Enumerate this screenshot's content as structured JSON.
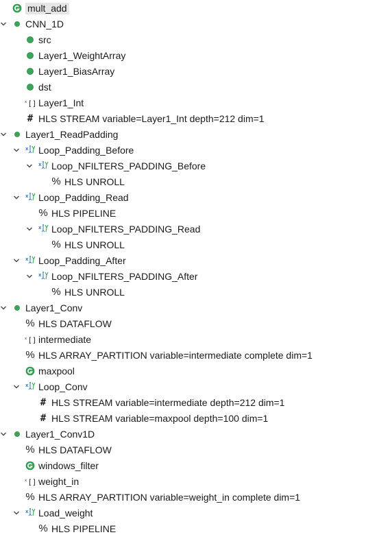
{
  "tree": [
    {
      "label": "mult_add",
      "icon": "function-icon",
      "depth": 0,
      "expanded": null,
      "selected": true
    },
    {
      "label": "CNN_1D",
      "icon": "top-function-icon",
      "depth": 0,
      "expanded": true
    },
    {
      "label": "src",
      "icon": "port-icon",
      "depth": 1,
      "expanded": null
    },
    {
      "label": "Layer1_WeightArray",
      "icon": "port-icon",
      "depth": 1,
      "expanded": null
    },
    {
      "label": "Layer1_BiasArray",
      "icon": "port-icon",
      "depth": 1,
      "expanded": null
    },
    {
      "label": "dst",
      "icon": "port-icon",
      "depth": 1,
      "expanded": null
    },
    {
      "label": "Layer1_Int",
      "icon": "array-icon",
      "depth": 1,
      "expanded": null
    },
    {
      "label": "HLS STREAM variable=Layer1_Int depth=212 dim=1",
      "icon": "hash-directive-icon",
      "depth": 1,
      "expanded": null
    },
    {
      "label": "Layer1_ReadPadding",
      "icon": "top-function-icon",
      "depth": 0,
      "expanded": true
    },
    {
      "label": "Loop_Padding_Before",
      "icon": "loop-icon",
      "depth": 1,
      "expanded": true
    },
    {
      "label": "Loop_NFILTERS_PADDING_Before",
      "icon": "loop-icon",
      "depth": 2,
      "expanded": true
    },
    {
      "label": "HLS UNROLL",
      "icon": "percent-directive-icon",
      "depth": 3,
      "expanded": null
    },
    {
      "label": "Loop_Padding_Read",
      "icon": "loop-icon",
      "depth": 1,
      "expanded": true
    },
    {
      "label": "HLS PIPELINE",
      "icon": "percent-directive-icon",
      "depth": 2,
      "expanded": null
    },
    {
      "label": "Loop_NFILTERS_PADDING_Read",
      "icon": "loop-icon",
      "depth": 2,
      "expanded": true
    },
    {
      "label": "HLS UNROLL",
      "icon": "percent-directive-icon",
      "depth": 3,
      "expanded": null
    },
    {
      "label": "Loop_Padding_After",
      "icon": "loop-icon",
      "depth": 1,
      "expanded": true
    },
    {
      "label": "Loop_NFILTERS_PADDING_After",
      "icon": "loop-icon",
      "depth": 2,
      "expanded": true
    },
    {
      "label": "HLS UNROLL",
      "icon": "percent-directive-icon",
      "depth": 3,
      "expanded": null
    },
    {
      "label": "Layer1_Conv",
      "icon": "top-function-icon",
      "depth": 0,
      "expanded": true
    },
    {
      "label": "HLS DATAFLOW",
      "icon": "percent-directive-icon",
      "depth": 1,
      "expanded": null
    },
    {
      "label": "intermediate",
      "icon": "array-icon",
      "depth": 1,
      "expanded": null
    },
    {
      "label": "HLS ARRAY_PARTITION variable=intermediate complete dim=1",
      "icon": "percent-directive-icon",
      "depth": 1,
      "expanded": null
    },
    {
      "label": "maxpool",
      "icon": "function-icon",
      "depth": 1,
      "expanded": null
    },
    {
      "label": "Loop_Conv",
      "icon": "loop-icon",
      "depth": 1,
      "expanded": true
    },
    {
      "label": "HLS STREAM variable=intermediate depth=212 dim=1",
      "icon": "hash-directive-icon",
      "depth": 2,
      "expanded": null
    },
    {
      "label": "HLS STREAM variable=maxpool depth=100 dim=1",
      "icon": "hash-directive-icon",
      "depth": 2,
      "expanded": null
    },
    {
      "label": "Layer1_Conv1D",
      "icon": "top-function-icon",
      "depth": 0,
      "expanded": true
    },
    {
      "label": "HLS DATAFLOW",
      "icon": "percent-directive-icon",
      "depth": 1,
      "expanded": null
    },
    {
      "label": "windows_filter",
      "icon": "function-icon",
      "depth": 1,
      "expanded": null
    },
    {
      "label": "weight_in",
      "icon": "array-icon",
      "depth": 1,
      "expanded": null
    },
    {
      "label": "HLS ARRAY_PARTITION variable=weight_in complete dim=1",
      "icon": "percent-directive-icon",
      "depth": 1,
      "expanded": null
    },
    {
      "label": "Load_weight",
      "icon": "loop-icon",
      "depth": 1,
      "expanded": true
    },
    {
      "label": "HLS PIPELINE",
      "icon": "percent-directive-icon",
      "depth": 2,
      "expanded": null
    }
  ],
  "colors": {
    "green": "#3aa657",
    "green_dark": "#1f7a3a",
    "loop_blue": "#3b7fc4",
    "loop_green": "#39a852",
    "chevron": "#444444",
    "selected_bg": "#e6e6e6"
  }
}
